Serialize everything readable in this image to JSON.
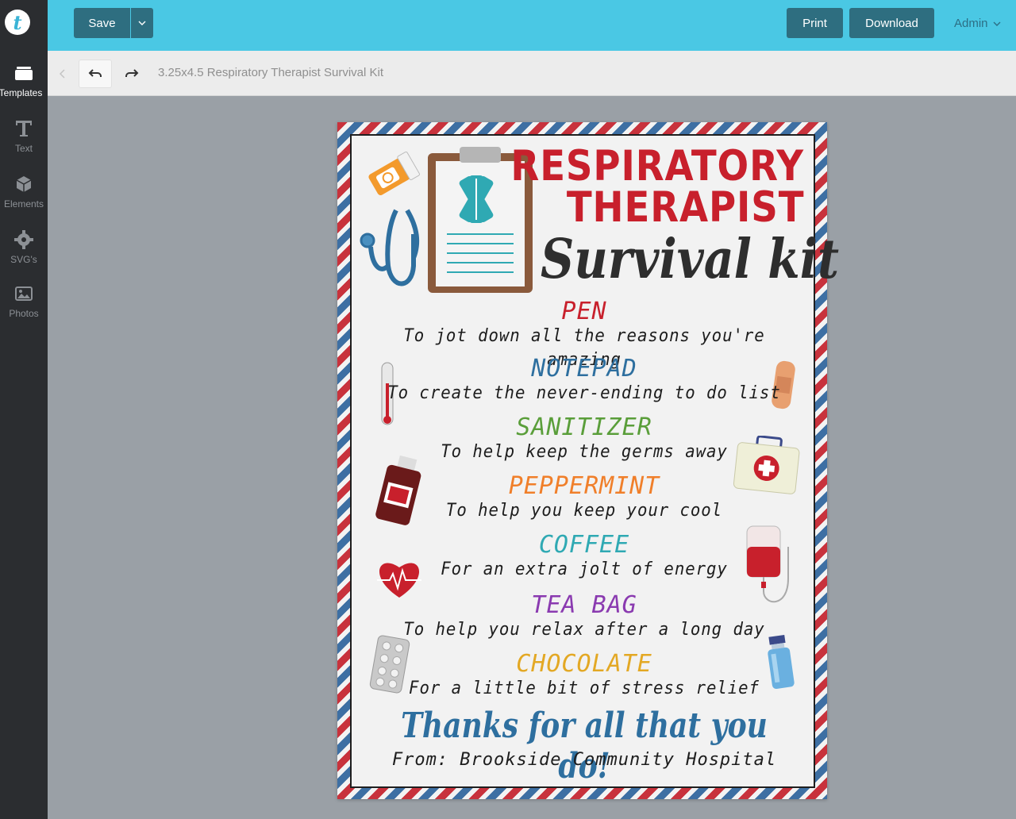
{
  "app": {
    "logo_letter": "t"
  },
  "sidebar": {
    "items": [
      {
        "label": "Templates",
        "icon": "templates-icon"
      },
      {
        "label": "Text",
        "icon": "text-icon"
      },
      {
        "label": "Elements",
        "icon": "elements-icon"
      },
      {
        "label": "SVG's",
        "icon": "svg-icon"
      },
      {
        "label": "Photos",
        "icon": "photos-icon"
      }
    ]
  },
  "topbar": {
    "save_label": "Save",
    "print_label": "Print",
    "download_label": "Download",
    "admin_label": "Admin"
  },
  "toolbar": {
    "doc_title": "3.25x4.5 Respiratory Therapist Survival Kit"
  },
  "card": {
    "title_line_1": "RESPIRATORY",
    "title_line_2": "THERAPIST",
    "title_script": "Survival kit",
    "items": [
      {
        "name": "PEN",
        "desc": "To jot down all the reasons you're amazing",
        "color": "#c8202c"
      },
      {
        "name": "NOTEPAD",
        "desc": "To create the never-ending to do list",
        "color": "#2e6f9f"
      },
      {
        "name": "SANITIZER",
        "desc": "To help keep the germs away",
        "color": "#5a9e3a"
      },
      {
        "name": "PEPPERMINT",
        "desc": "To help you keep your cool",
        "color": "#f07f2a"
      },
      {
        "name": "COFFEE",
        "desc": "For an extra jolt of energy",
        "color": "#2fa9b3"
      },
      {
        "name": "TEA BAG",
        "desc": "To help you relax after a long day",
        "color": "#8a3ab0"
      },
      {
        "name": "CHOCOLATE",
        "desc": "For a little bit of stress relief",
        "color": "#e3a824"
      }
    ],
    "thanks": "Thanks for all that you do!",
    "from": "From: Brookside Community Hospital"
  },
  "colors": {
    "topbar": "#4ac8e4",
    "button": "#2e6e80",
    "sidebar": "#2b2d30",
    "stripe_red": "#c8323c",
    "stripe_blue": "#3d6fa3"
  }
}
